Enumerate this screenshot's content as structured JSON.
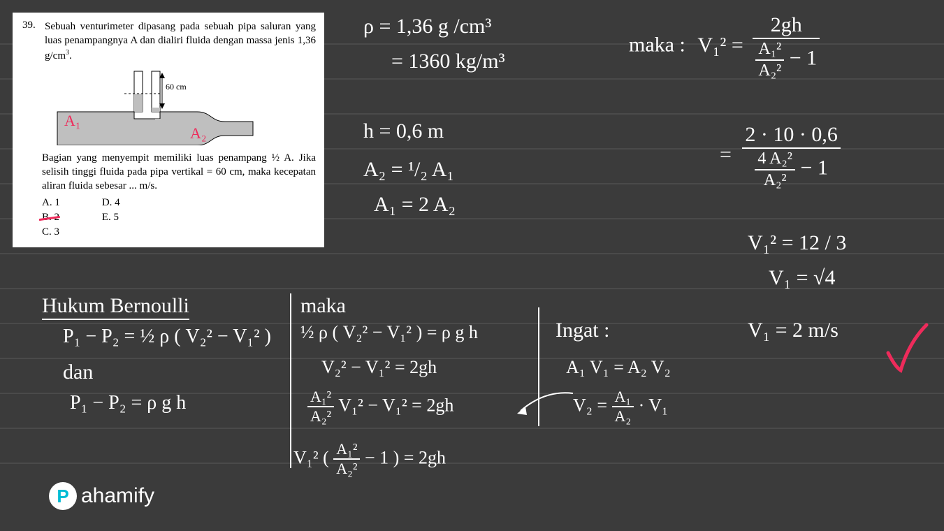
{
  "question": {
    "number": "39.",
    "text_line1": "Sebuah venturimeter dipasang pada sebuah pipa saluran yang luas penampangnya A dan dialiri fluida dengan massa jenis 1,36 g/cm",
    "text_sup": "3",
    "text_end": ".",
    "diagram_height_label": "60 cm",
    "label_A1": "A₁",
    "label_A2": "A₂",
    "text_line2": "Bagian yang menyempit memiliki luas penampang ½ A. Jika selisih tinggi fluida pada pipa vertikal = 60 cm, maka kecepatan aliran fluida sebesar ... m/s.",
    "answers": {
      "A": "A.  1",
      "B": "B.  2",
      "C": "C.  3",
      "D": "D.  4",
      "E": "E.  5"
    }
  },
  "handwriting": {
    "rho1": "ρ = 1,36 g /cm³",
    "rho2": "= 1360 kg/m³",
    "h": "h = 0,6 m",
    "A2_eq": "A₂ = ¹/₂ A₁",
    "A1_eq": "A₁ = 2 A₂",
    "maka_label": "maka :",
    "v1sq_eq": "V₁² =",
    "frac_top1_num": "2gh",
    "frac_top1_den_num": "A₁²",
    "frac_top1_den_den": "A₂²",
    "minus1": " − 1",
    "eq_sub": "=",
    "frac2_num": "2 · 10 · 0,6",
    "frac2_den_num": "4 A₂²",
    "frac2_den_den": "A₂²",
    "v1sq_res": "V₁² = 12 / 3",
    "v1_res": "V₁ = √4",
    "v1_final": "V₁ = 2 m/s",
    "hukum_title": "Hukum Bernoulli",
    "eq_p1": "P₁ − P₂ = ½ ρ ( V₂² − V₁² )",
    "dan": "dan",
    "eq_p2": "P₁ − P₂ = ρ g h",
    "maka2": "maka",
    "eq_m1": "½ ρ ( V₂² − V₁² ) = ρ g h",
    "eq_m2": "V₂² − V₁² = 2gh",
    "eq_m3_num": "A₁²",
    "eq_m3_den": "A₂²",
    "eq_m3_tail": " V₁² − V₁² = 2gh",
    "eq_m4_lead": "V₁² (",
    "eq_m4_frac_num": "A₁²",
    "eq_m4_frac_den": "A₂²",
    "eq_m4_tail": " − 1 ) = 2gh",
    "ingat": "Ingat :",
    "cont1": "A₁ V₁ = A₂ V₂",
    "cont2_lead": "V₂ = ",
    "cont2_num": "A₁",
    "cont2_den": "A₂",
    "cont2_tail": " · V₁"
  },
  "logo": "ahamify",
  "logo_letter": "P"
}
